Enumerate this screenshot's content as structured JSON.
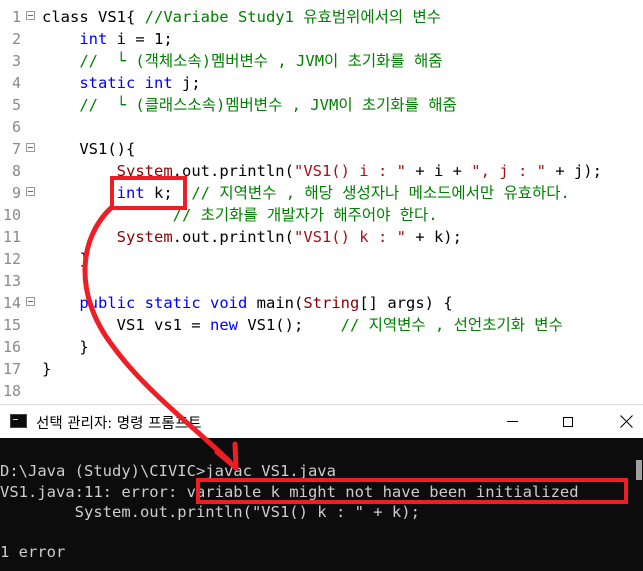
{
  "editor": {
    "lines": [
      {
        "num": "1",
        "fold": true,
        "parts": [
          {
            "t": "class VS1{ ",
            "c": "plain"
          },
          {
            "t": "//Variabe Study1 유효범위에서의 변수",
            "c": "cm"
          }
        ]
      },
      {
        "num": "2",
        "fold": false,
        "parts": [
          {
            "t": "    ",
            "c": "plain"
          },
          {
            "t": "int",
            "c": "kw"
          },
          {
            "t": " i = 1;",
            "c": "plain"
          }
        ]
      },
      {
        "num": "3",
        "fold": false,
        "parts": [
          {
            "t": "    ",
            "c": "plain"
          },
          {
            "t": "//  └ (객체소속)멤버변수 , JVM이 초기화를 해줌",
            "c": "cm"
          }
        ]
      },
      {
        "num": "4",
        "fold": false,
        "parts": [
          {
            "t": "    ",
            "c": "plain"
          },
          {
            "t": "static",
            "c": "kw"
          },
          {
            "t": " ",
            "c": "plain"
          },
          {
            "t": "int",
            "c": "kw"
          },
          {
            "t": " j;",
            "c": "plain"
          }
        ]
      },
      {
        "num": "5",
        "fold": false,
        "parts": [
          {
            "t": "    ",
            "c": "plain"
          },
          {
            "t": "//  └ (클래스소속)멤버변수 , JVM이 초기화를 해줌",
            "c": "cm"
          }
        ]
      },
      {
        "num": "6",
        "fold": false,
        "parts": []
      },
      {
        "num": "7",
        "fold": true,
        "parts": [
          {
            "t": "    VS1(){",
            "c": "plain"
          }
        ]
      },
      {
        "num": "8",
        "fold": false,
        "parts": [
          {
            "t": "        ",
            "c": "plain"
          },
          {
            "t": "System",
            "c": "sys"
          },
          {
            "t": ".out.println(",
            "c": "plain"
          },
          {
            "t": "\"VS1() i : \"",
            "c": "str"
          },
          {
            "t": " + i + ",
            "c": "plain"
          },
          {
            "t": "\", j : \"",
            "c": "str"
          },
          {
            "t": " + j);",
            "c": "plain"
          }
        ]
      },
      {
        "num": "9",
        "fold": true,
        "parts": [
          {
            "t": "        ",
            "c": "plain"
          },
          {
            "t": "int",
            "c": "kw"
          },
          {
            "t": " k;  ",
            "c": "plain"
          },
          {
            "t": "// 지역변수 , 해당 생성자나 메소드에서만 유효하다.",
            "c": "cm"
          }
        ]
      },
      {
        "num": "10",
        "fold": false,
        "parts": [
          {
            "t": "              ",
            "c": "plain"
          },
          {
            "t": "// 초기화를 개발자가 해주어야 한다.",
            "c": "cm"
          }
        ]
      },
      {
        "num": "11",
        "fold": false,
        "parts": [
          {
            "t": "        ",
            "c": "plain"
          },
          {
            "t": "System",
            "c": "sys"
          },
          {
            "t": ".out.println(",
            "c": "plain"
          },
          {
            "t": "\"VS1() k : \"",
            "c": "str"
          },
          {
            "t": " + k);",
            "c": "plain"
          }
        ]
      },
      {
        "num": "12",
        "fold": false,
        "parts": [
          {
            "t": "    }",
            "c": "plain"
          }
        ]
      },
      {
        "num": "13",
        "fold": false,
        "parts": []
      },
      {
        "num": "14",
        "fold": true,
        "parts": [
          {
            "t": "    ",
            "c": "plain"
          },
          {
            "t": "public",
            "c": "kw"
          },
          {
            "t": " ",
            "c": "plain"
          },
          {
            "t": "static",
            "c": "kw"
          },
          {
            "t": " ",
            "c": "plain"
          },
          {
            "t": "void",
            "c": "kw"
          },
          {
            "t": " main(",
            "c": "plain"
          },
          {
            "t": "String",
            "c": "sys"
          },
          {
            "t": "[] args) {",
            "c": "plain"
          }
        ]
      },
      {
        "num": "15",
        "fold": false,
        "parts": [
          {
            "t": "        VS1 vs1 = ",
            "c": "plain"
          },
          {
            "t": "new",
            "c": "kw"
          },
          {
            "t": " VS1();    ",
            "c": "plain"
          },
          {
            "t": "// 지역변수 , 선언초기화 변수",
            "c": "cm"
          }
        ]
      },
      {
        "num": "16",
        "fold": false,
        "parts": [
          {
            "t": "    }",
            "c": "plain"
          }
        ]
      },
      {
        "num": "17",
        "fold": false,
        "parts": [
          {
            "t": "}",
            "c": "plain"
          }
        ]
      },
      {
        "num": "18",
        "fold": false,
        "parts": []
      }
    ]
  },
  "console": {
    "title": "선택 관리자: 명령 프롬프트",
    "lines": [
      "",
      "D:\\Java (Study)\\CIVIC>javac VS1.java",
      "VS1.java:11: error: variable k might not have been initialized",
      "        System.out.println(\"VS1() k : \" + k);",
      "",
      "1 error"
    ]
  },
  "colors": {
    "highlight": "#ee1e24",
    "console_bg": "#0c0c0c",
    "console_text": "#cccccc",
    "keyword": "#0000ff",
    "comment": "#008000",
    "string": "#a31515"
  },
  "icons": {
    "window_icon": "cmd-icon",
    "minimize": "minimize-icon",
    "maximize": "maximize-icon",
    "close": "close-icon"
  }
}
